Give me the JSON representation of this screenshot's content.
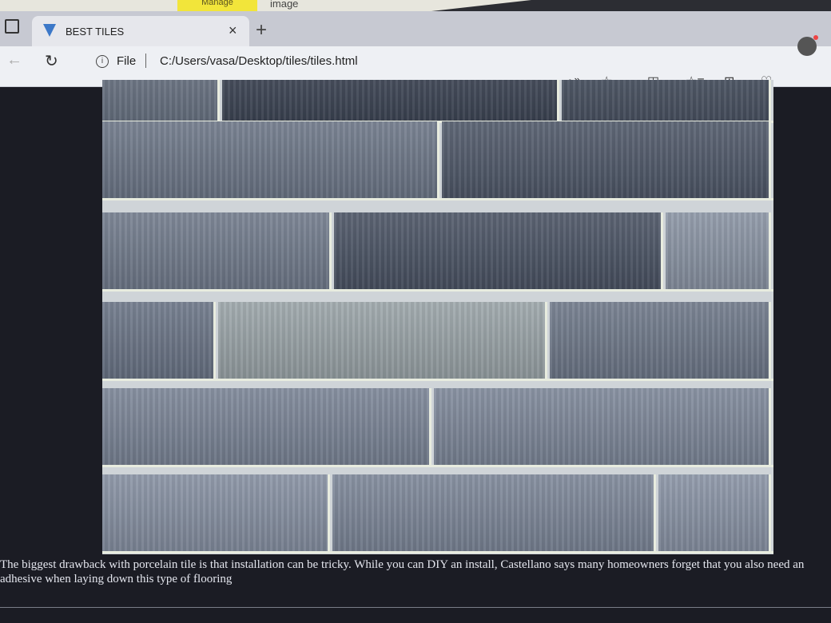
{
  "ribbon": {
    "manage_label": "Manage",
    "image_label": "image"
  },
  "browser": {
    "tab_title": "BEST TILES",
    "tab_close": "×",
    "new_tab": "+",
    "file_label": "File",
    "url": "C:/Users/vasa/Desktop/tiles/tiles.html",
    "icons": [
      "sidebar-icon",
      "back-icon",
      "refresh-icon",
      "info-icon",
      "read-aloud-icon",
      "favorite-icon",
      "split-screen-icon",
      "favorites-list-icon",
      "collections-icon",
      "health-icon",
      "profile-icon"
    ]
  },
  "page": {
    "caption": "The biggest drawback with porcelain tile is that installation can be tricky. While you can DIY an install, Castellano says many homeowners forget that you also need an adhesive when laying down this type of flooring"
  },
  "colors": {
    "page_bg": "#1b1c24",
    "tile_dark": "#4a5363",
    "tile_light": "#8b97a8",
    "grout": "#e8ecdf"
  }
}
